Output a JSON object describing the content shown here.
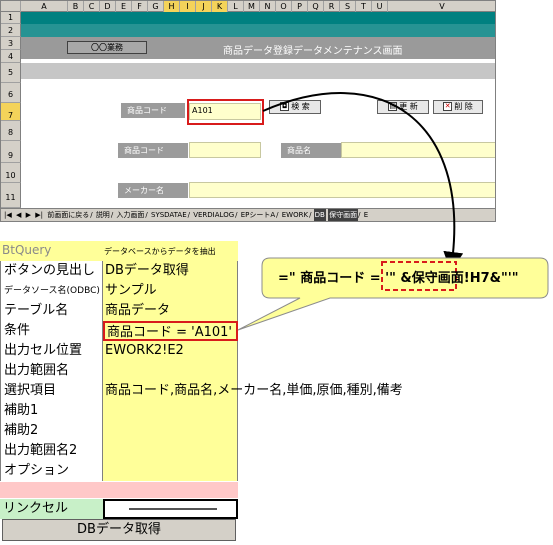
{
  "sheet": {
    "columns": [
      "A",
      "B",
      "C",
      "D",
      "E",
      "F",
      "G",
      "H",
      "I",
      "J",
      "K",
      "L",
      "M",
      "N",
      "O",
      "P",
      "Q",
      "R",
      "S",
      "T",
      "U",
      "V"
    ],
    "rows": [
      "1",
      "2",
      "3",
      "4",
      "5",
      "6",
      "7",
      "8",
      "9",
      "10",
      "11"
    ],
    "system_label": "〇〇業務",
    "screen_title": "商品データ登録データメンテナンス画面",
    "label_product_code_search": "商品コード",
    "input_product_code_value": "A101",
    "search_button": "検 索",
    "update_button": "更 新",
    "delete_button": "削 除",
    "label_product_code": "商品コード",
    "label_product_name": "商品名",
    "label_maker_name": "メーカー名",
    "tabs": [
      "|◀",
      "◀",
      "▶",
      "▶|",
      "前画面に戻る",
      "説明",
      "入力画面",
      "SYSDATAE",
      "VERDIALOG",
      "EPシートA",
      "EWORK",
      "DB",
      "保守画面",
      "E"
    ]
  },
  "table": {
    "header_left": "BtQuery",
    "header_right": "データベースからデータを抽出",
    "rows": [
      {
        "key": "ボタンの見出し",
        "value": "DBデータ取得"
      },
      {
        "key": "データソース名(ODBC)",
        "value": "サンプル"
      },
      {
        "key": "テーブル名",
        "value": "商品データ"
      },
      {
        "key": "条件",
        "value": "商品コード = 'A101'"
      },
      {
        "key": "出力セル位置",
        "value": "EWORK2!E2"
      },
      {
        "key": "出力範囲名",
        "value": ""
      },
      {
        "key": "選択項目",
        "value": "商品コード,商品名,メーカー名,単価,原価,種別,備考"
      },
      {
        "key": "補助1",
        "value": ""
      },
      {
        "key": "補助2",
        "value": ""
      },
      {
        "key": "出力範囲名2",
        "value": ""
      },
      {
        "key": "オプション",
        "value": ""
      }
    ],
    "link_cell_label": "リンクセル",
    "db_button": "DBデータ取得"
  },
  "callout": {
    "formula_prefix": "=\" 商品コード = '\" &",
    "formula_highlight": "保守画面!H7",
    "formula_suffix": "&\"'\""
  },
  "colors": {
    "teal": "#008080",
    "grey_bar": "#b0b0b0",
    "input_yellow": "#ffffcc",
    "callout_yellow": "#ffff99",
    "highlight_red": "#d81b1b"
  }
}
